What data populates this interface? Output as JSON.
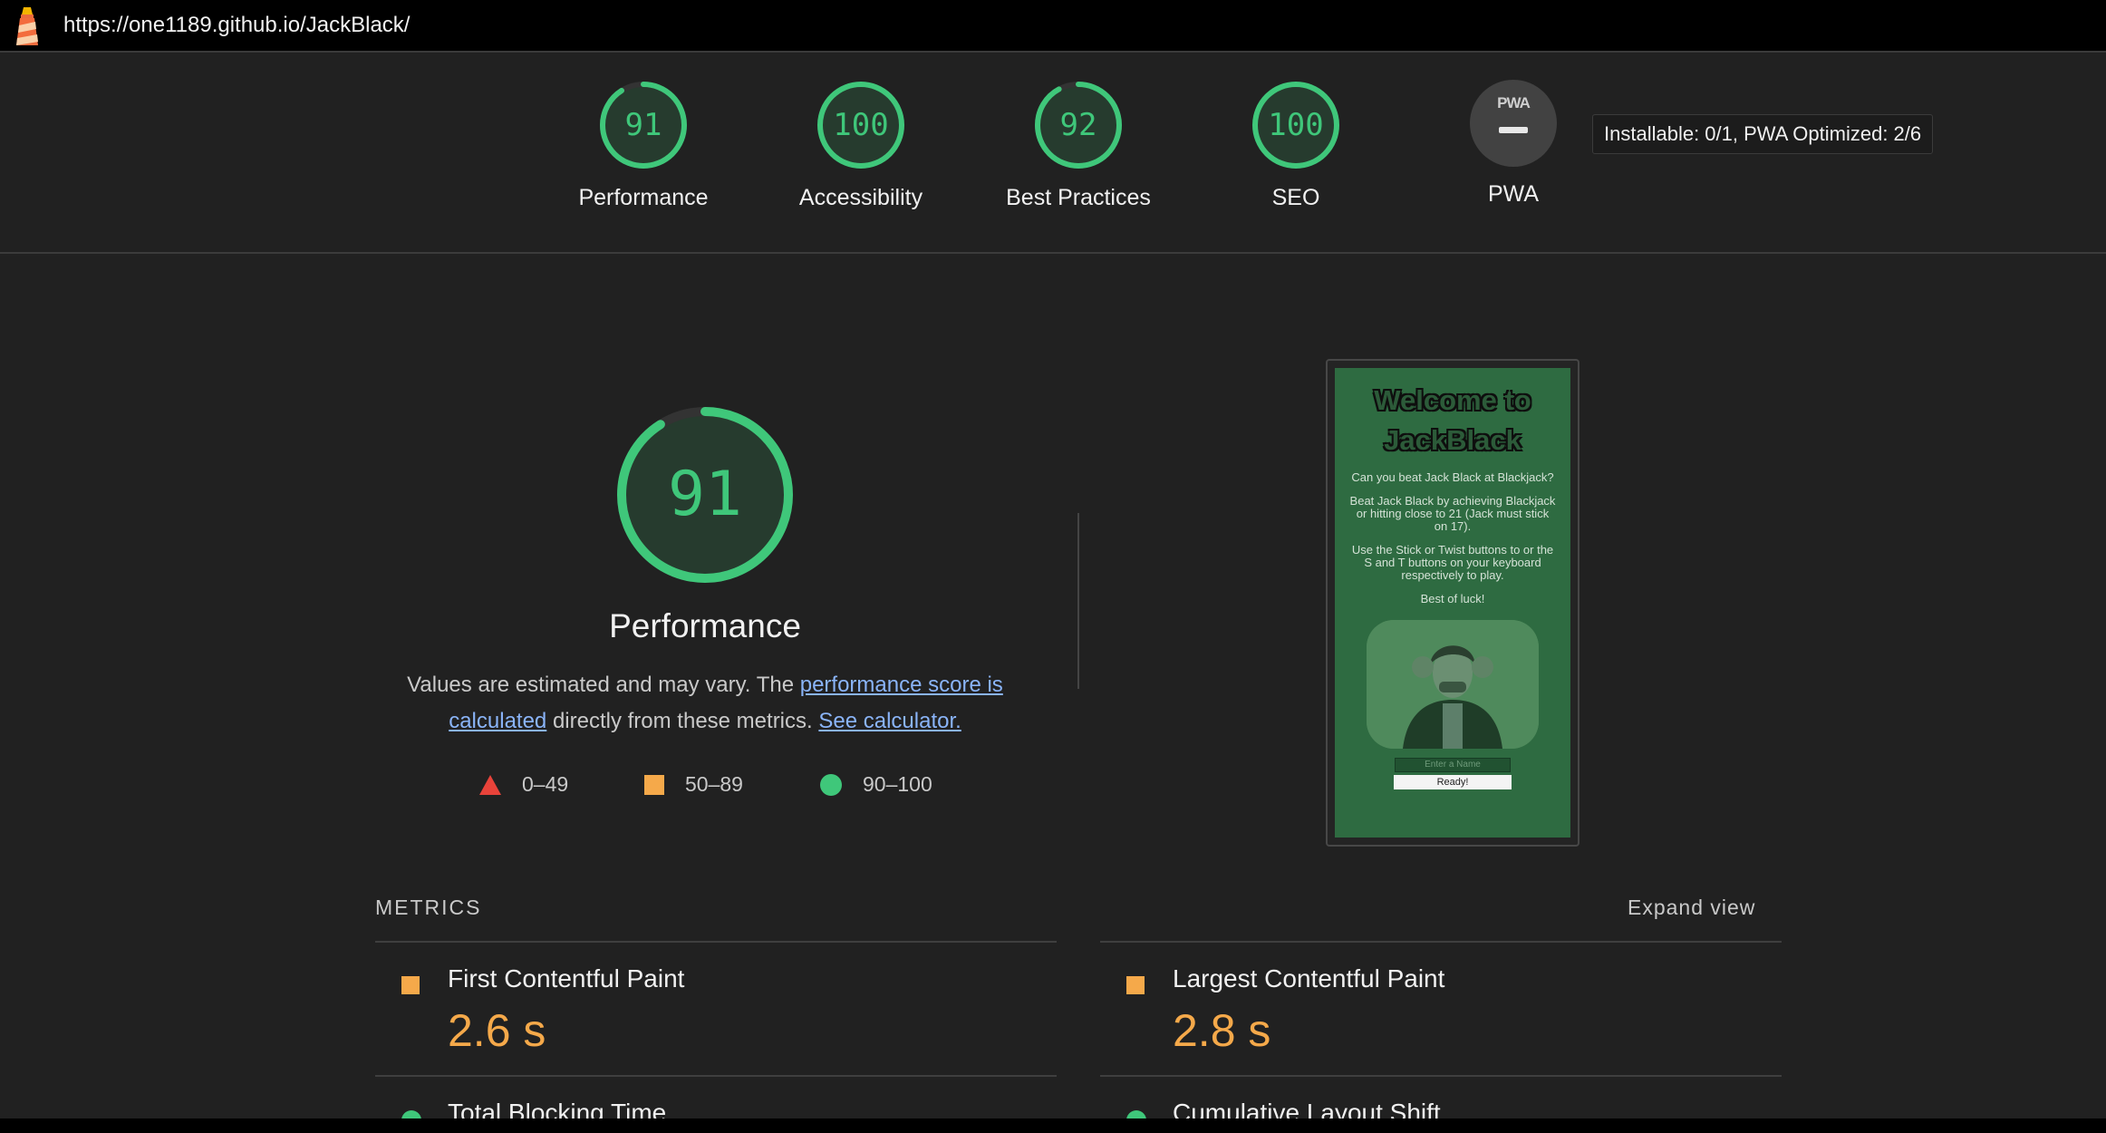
{
  "browser": {
    "url": "https://one1189.github.io/JackBlack/"
  },
  "summary": {
    "gauges": [
      {
        "score": "91",
        "label": "Performance"
      },
      {
        "score": "100",
        "label": "Accessibility"
      },
      {
        "score": "92",
        "label": "Best Practices"
      },
      {
        "score": "100",
        "label": "SEO"
      }
    ],
    "pwa": {
      "badge": "PWA",
      "label": "PWA"
    },
    "tooltip": "Installable: 0/1, PWA Optimized: 2/6"
  },
  "performance": {
    "score": "91",
    "title": "Performance",
    "desc_prefix": "Values are estimated and may vary. The ",
    "desc_link": "performance score is calculated",
    "desc_mid": " directly from these metrics. ",
    "desc_link2": "See calculator.",
    "legend": [
      "0–49",
      "50–89",
      "90–100"
    ]
  },
  "screenshot": {
    "title_line1": "Welcome to",
    "title_line2": "JackBlack",
    "p1": "Can you beat Jack Black at Blackjack?",
    "p2": "Beat Jack Black by achieving Blackjack or hitting close to 21 (Jack must stick on 17).",
    "p3": "Use the Stick or Twist buttons to or the S and T buttons on your keyboard respectively to play.",
    "p4": "Best of luck!",
    "input_placeholder": "Enter a Name",
    "button": "Ready!"
  },
  "metrics": {
    "heading": "METRICS",
    "expand": "Expand view",
    "items": [
      {
        "label": "First Contentful Paint",
        "value": "2.6 s"
      },
      {
        "label": "Largest Contentful Paint",
        "value": "2.8 s"
      },
      {
        "label": "Total Blocking Time",
        "value": ""
      },
      {
        "label": "Cumulative Layout Shift",
        "value": ""
      }
    ]
  },
  "colors": {
    "pass": "#3fc77a",
    "average": "#f5a94a",
    "fail": "#e8433a",
    "link": "#8ab4f8"
  }
}
